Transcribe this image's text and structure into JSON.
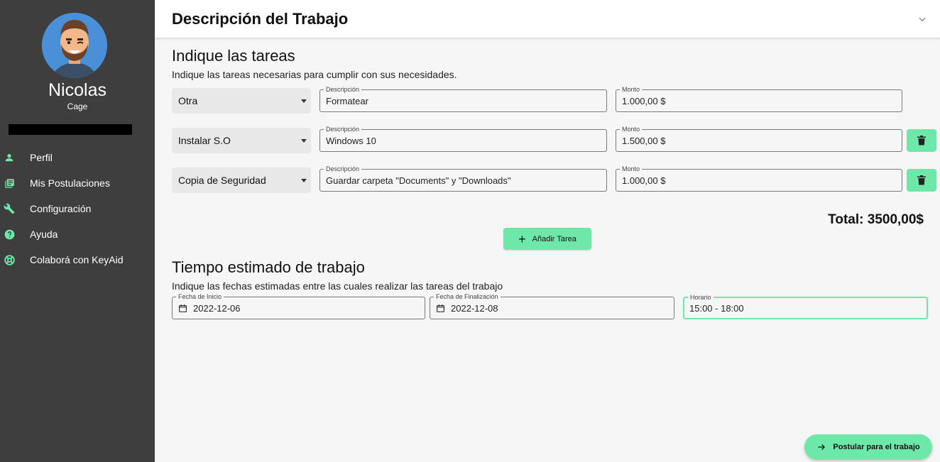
{
  "sidebar": {
    "user_first_name": "Nicolas",
    "user_last_name": "Cage",
    "items": [
      {
        "label": "Perfil",
        "icon": "person-icon"
      },
      {
        "label": "Mis Postulaciones",
        "icon": "library-books-icon"
      },
      {
        "label": "Configuración",
        "icon": "wrench-icon"
      },
      {
        "label": "Ayuda",
        "icon": "help-icon"
      },
      {
        "label": "Colaborá con KeyAid",
        "icon": "lifebuoy-icon"
      }
    ]
  },
  "header": {
    "title": "Descripción del Trabajo"
  },
  "tasks_section": {
    "title": "Indique las tareas",
    "subtitle": "Indique las tareas necesarias para cumplir con sus necesidades.",
    "description_label": "Descripción",
    "amount_label": "Monto",
    "tasks": [
      {
        "type": "Otra",
        "description": "Formatear",
        "amount": "1.000,00 $"
      },
      {
        "type": "Instalar S.O",
        "description": "Windows 10",
        "amount": "1.500,00 $"
      },
      {
        "type": "Copia de Seguridad",
        "description": "Guardar carpeta \"Documents\" y \"Downloads\"",
        "amount": "1.000,00 $"
      }
    ],
    "total": "Total: 3500,00$",
    "add_button": "Añadir Tarea"
  },
  "time_section": {
    "title": "Tiempo estimado de trabajo",
    "subtitle": "Indique las fechas estimadas entre las cuales realizar las tareas del trabajo",
    "start_label": "Fecha de Inicio",
    "start_value": "2022-12-06",
    "end_label": "Fecha de Finalización",
    "end_value": "2022-12-08",
    "schedule_label": "Horario",
    "schedule_value": "15:00 - 18:00"
  },
  "apply_button": "Postular para el trabajo",
  "colors": {
    "accent": "#6ee8a8",
    "sidebar": "#3e3e3e",
    "avatar_bg": "#4a90d9"
  }
}
